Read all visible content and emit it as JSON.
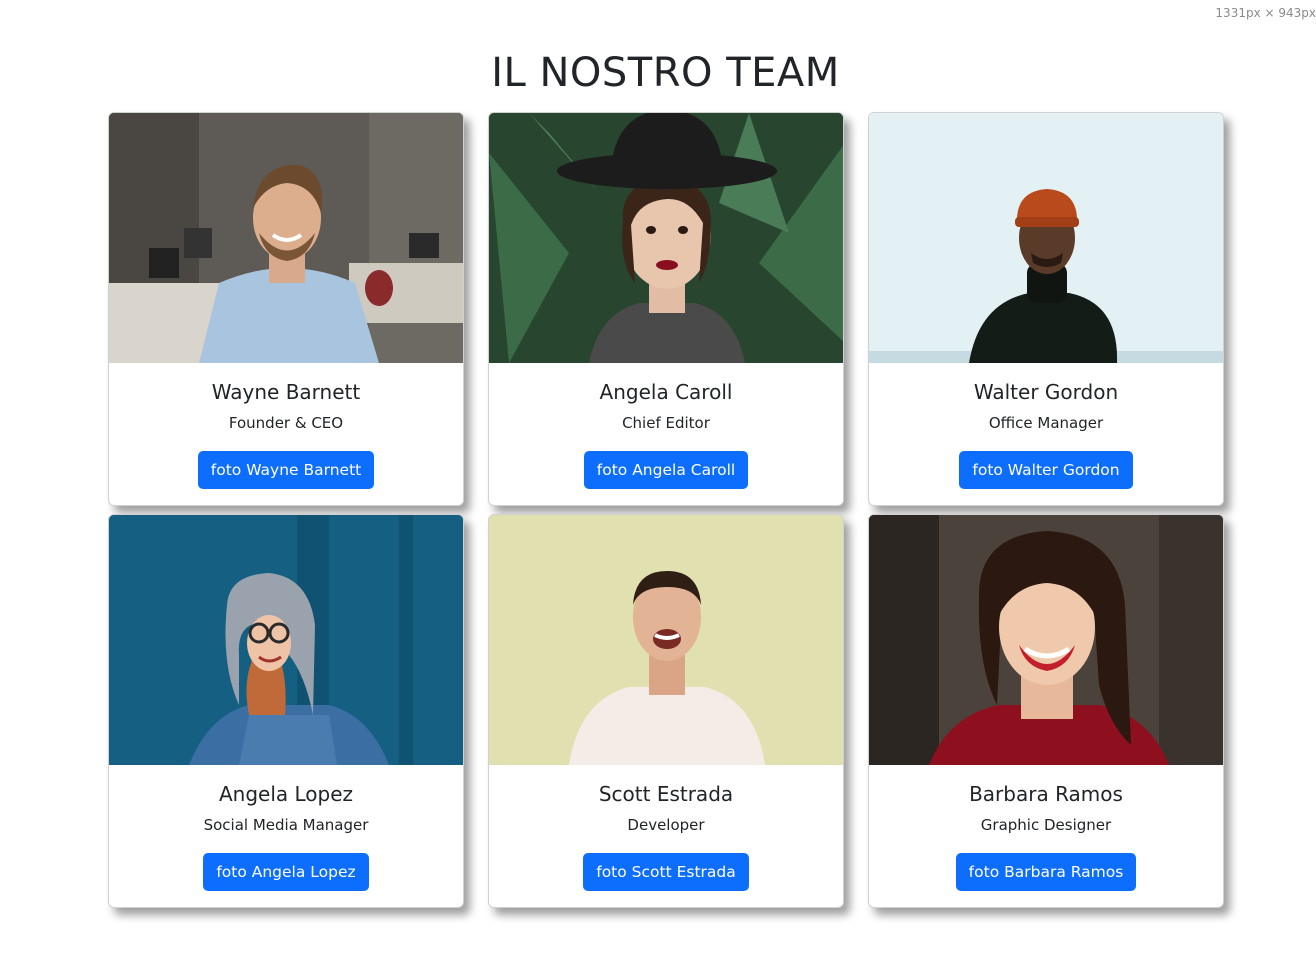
{
  "viewport_label": "1331px × 943px",
  "title": "IL NOSTRO TEAM",
  "team": [
    {
      "name": "Wayne Barnett",
      "role": "Founder & CEO",
      "button": "foto Wayne Barnett"
    },
    {
      "name": "Angela Caroll",
      "role": "Chief Editor",
      "button": "foto Angela Caroll"
    },
    {
      "name": "Walter Gordon",
      "role": "Office Manager",
      "button": "foto Walter Gordon"
    },
    {
      "name": "Angela Lopez",
      "role": "Social Media Manager",
      "button": "foto Angela Lopez"
    },
    {
      "name": "Scott Estrada",
      "role": "Developer",
      "button": "foto Scott Estrada"
    },
    {
      "name": "Barbara Ramos",
      "role": "Graphic Designer",
      "button": "foto Barbara Ramos"
    }
  ],
  "colors": {
    "button": "#0d6efd",
    "text": "#212529"
  }
}
